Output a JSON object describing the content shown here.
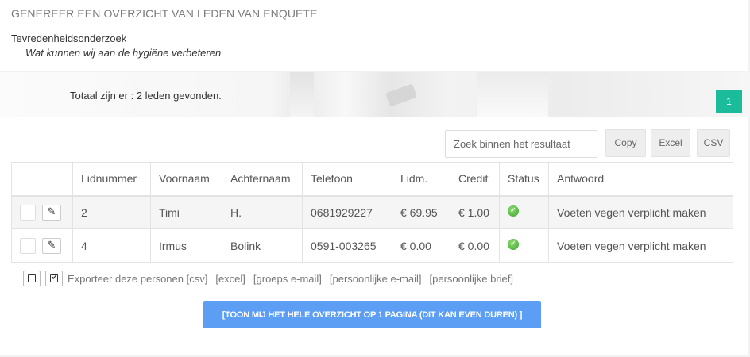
{
  "header": {
    "title": "GENEREER EEN OVERZICHT VAN LEDEN VAN ENQUETE",
    "survey_name": "Tevredenheidsonderzoek",
    "question": "Wat kunnen wij aan de hygiëne verbeteren"
  },
  "results": {
    "total_text": "Totaal zijn er : 2 leden gevonden.",
    "page_number": "1"
  },
  "toolbar": {
    "search_placeholder": "Zoek binnen het resultaat",
    "copy_label": "Copy",
    "excel_label": "Excel",
    "csv_label": "CSV"
  },
  "table": {
    "headers": [
      "",
      "Lidnummer",
      "Voornaam",
      "Achternaam",
      "Telefoon",
      "Lidm.",
      "Credit",
      "Status",
      "Antwoord"
    ],
    "rows": [
      {
        "lidnummer": "2",
        "voornaam": "Timi",
        "achternaam": "H.",
        "telefoon": "0681929227",
        "lidm": "€ 69.95",
        "credit": "€ 1.00",
        "status": "ok-icon",
        "antwoord": "Voeten vegen verplicht maken"
      },
      {
        "lidnummer": "4",
        "voornaam": "Irmus",
        "achternaam": "Bolink",
        "telefoon": "0591-003265",
        "lidm": "€ 0.00",
        "credit": "€ 0.00",
        "status": "ok-icon",
        "antwoord": "Voeten vegen verplicht maken"
      }
    ]
  },
  "export": {
    "lead": "Exporteer deze personen [csv]",
    "excel": "[excel]",
    "group_email": "[groeps e-mail]",
    "personal_email": "[persoonlijke e-mail]",
    "personal_letter": "[persoonlijke brief]"
  },
  "show_all_label": "[TOON MIJ HET HELE OVERZICHT OP 1 PAGINA (DIT KAN EVEN DUREN) ]",
  "colors": {
    "accent_teal": "#1abc9c",
    "primary_blue": "#5b9ef4",
    "status_green": "#3aa531"
  }
}
